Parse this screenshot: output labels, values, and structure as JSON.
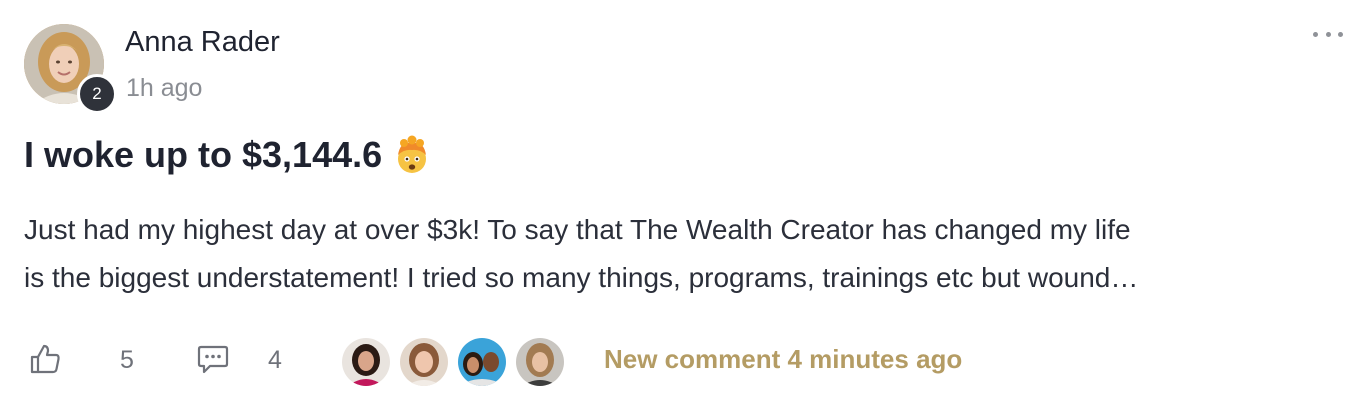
{
  "author": {
    "name": "Anna Rader",
    "level": "2",
    "time": "1h ago"
  },
  "post": {
    "title": "I woke up to $3,144.6",
    "title_emoji": "exploding-head-emoji",
    "body_lines": [
      "Just had my highest day at over $3k! To say that The Wealth Creator has changed my life",
      "is the biggest understatement! I tried so many things, programs, trainings etc but wound…"
    ]
  },
  "footer": {
    "likes": "5",
    "comments": "4",
    "new_comment_text": "New comment 4 minutes ago"
  },
  "icons": {
    "more": "more-horizontal-icon",
    "like": "thumbs-up-icon",
    "comment": "comment-bubble-icon"
  },
  "colors": {
    "accent_gold": "#b49c64",
    "text_primary": "#1f2330",
    "text_muted": "#8a8d93",
    "badge_bg": "#2f323a"
  }
}
